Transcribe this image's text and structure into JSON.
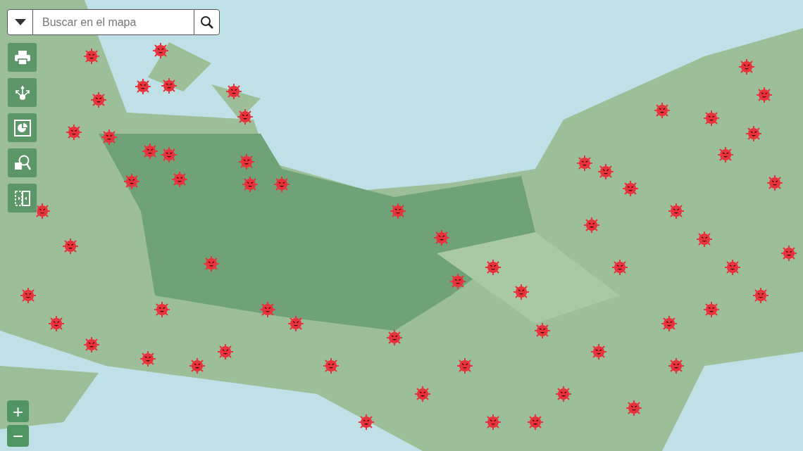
{
  "search": {
    "placeholder": "Buscar en el mapa"
  },
  "tools": [
    {
      "kind": "print"
    },
    {
      "kind": "share"
    },
    {
      "kind": "chart"
    },
    {
      "kind": "query"
    },
    {
      "kind": "compare"
    }
  ],
  "zoom": [
    {
      "label": "+"
    },
    {
      "label": "−"
    }
  ]
}
